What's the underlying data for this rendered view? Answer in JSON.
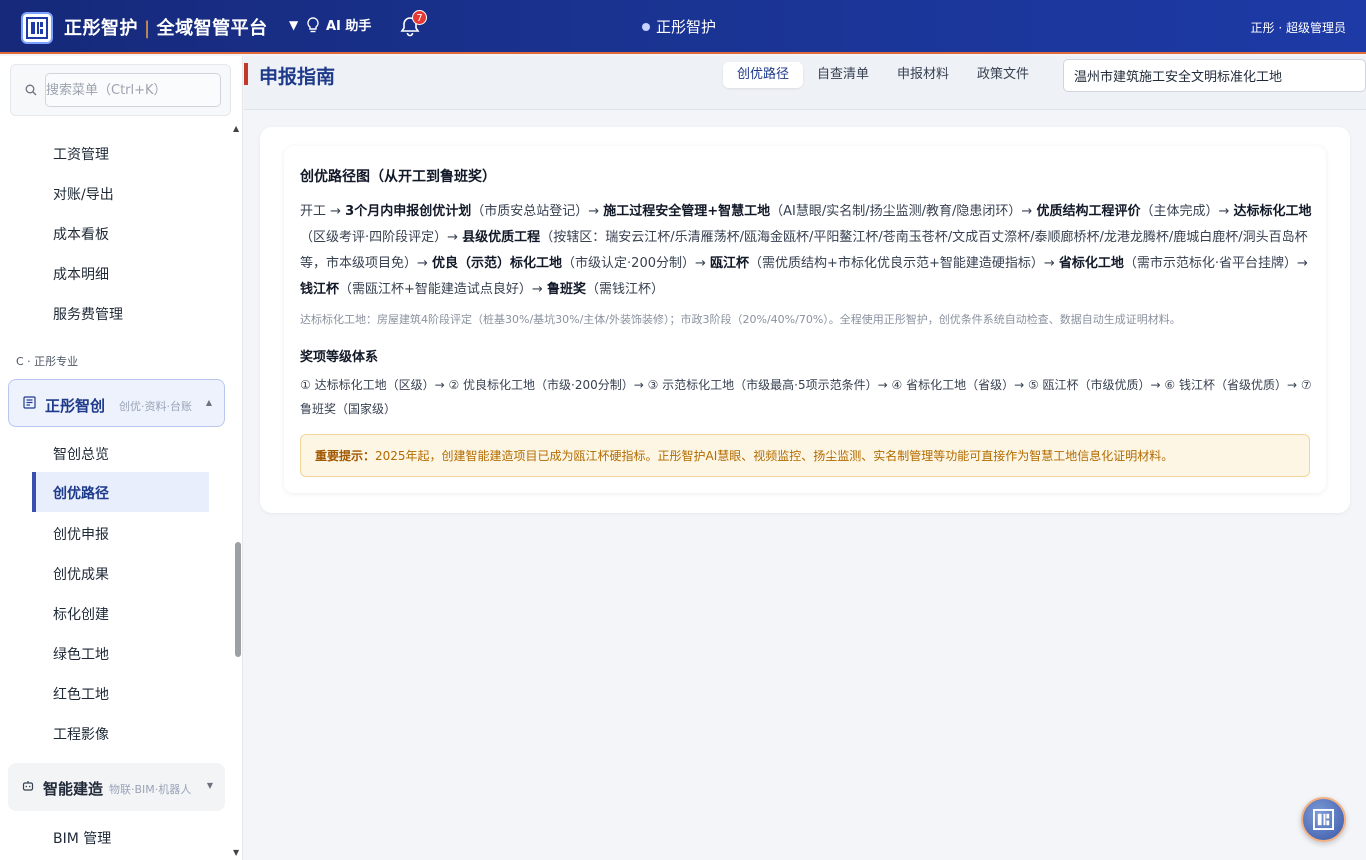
{
  "topbar": {
    "brand_name": "正彤智护",
    "brand_platform": "全域智管平台",
    "ai_label": "AI 助手",
    "notification_count": "7",
    "center_title": "正彤智护",
    "user_role": "正彤 · 超级管理员"
  },
  "sidebar": {
    "search_placeholder": "搜索菜单（Ctrl+K）",
    "items_top": [
      "工资管理",
      "对账/导出",
      "成本看板",
      "成本明细",
      "服务费管理"
    ],
    "section_label": "C · 正彤专业",
    "group_active": {
      "title": "正彤智创",
      "subtitle": "创优·资料·台账"
    },
    "group_items": [
      "智创总览",
      "创优路径",
      "创优申报",
      "创优成果",
      "标化创建",
      "绿色工地",
      "红色工地",
      "工程影像"
    ],
    "group_2": {
      "title": "智能建造",
      "subtitle": "物联·BIM·机器人"
    },
    "items_bottom": [
      "BIM 管理"
    ]
  },
  "header": {
    "page_title": "申报指南",
    "tabs": [
      "创优路径",
      "自查清单",
      "申报材料",
      "政策文件"
    ],
    "project_value": "温州市建筑施工安全文明标准化工地"
  },
  "content": {
    "title": "创优路径图（从开工到鲁班奖）",
    "path": [
      {
        "t": "开工 → ",
        "b": false
      },
      {
        "t": "3个月内申报创优计划",
        "b": true
      },
      {
        "t": "（市质安总站登记）→ ",
        "b": false
      },
      {
        "t": "施工过程安全管理+智慧工地",
        "b": true
      },
      {
        "t": "（AI慧眼/实名制/扬尘监测/教育/隐患闭环）→ ",
        "b": false
      },
      {
        "t": "优质结构工程评价",
        "b": true
      },
      {
        "t": "（主体完成）→ ",
        "b": false
      },
      {
        "t": "达标标化工地",
        "b": true
      },
      {
        "t": "（区级考评·四阶段评定）→ ",
        "b": false
      },
      {
        "t": "县级优质工程",
        "b": true
      },
      {
        "t": "（按辖区：瑞安云江杯/乐清雁荡杯/瓯海金瓯杯/平阳鳌江杯/苍南玉苍杯/文成百丈漈杯/泰顺廊桥杯/龙港龙腾杯/鹿城白鹿杯/洞头百岛杯等，市本级项目免）→ ",
        "b": false
      },
      {
        "t": "优良（示范）标化工地",
        "b": true
      },
      {
        "t": "（市级认定·200分制）→ ",
        "b": false
      },
      {
        "t": "瓯江杯",
        "b": true
      },
      {
        "t": "（需优质结构+市标化优良示范+智能建造硬指标）→ ",
        "b": false
      },
      {
        "t": "省标化工地",
        "b": true
      },
      {
        "t": "（需市示范标化·省平台挂牌）→ ",
        "b": false
      },
      {
        "t": "钱江杯",
        "b": true
      },
      {
        "t": "（需瓯江杯+智能建造试点良好）→ ",
        "b": false
      },
      {
        "t": "鲁班奖",
        "b": true
      },
      {
        "t": "（需钱江杯）",
        "b": false
      }
    ],
    "note": "达标标化工地：房屋建筑4阶段评定（桩基30%/基坑30%/主体/外装饰装修）；市政3阶段（20%/40%/70%）。全程使用正彤智护，创优条件系统自动检查、数据自动生成证明材料。",
    "levels_title": "奖项等级体系",
    "levels": "① 达标标化工地（区级）→ ② 优良标化工地（市级·200分制）→ ③ 示范标化工地（市级最高·5项示范条件）→ ④ 省标化工地（省级）→ ⑤ 瓯江杯（市级优质）→ ⑥ 钱江杯（省级优质）→ ⑦ 鲁班奖（国家级）",
    "tip_label": "重要提示：",
    "tip_text": "2025年起，创建智能建造项目已成为瓯江杯硬指标。正彤智护AI慧眼、视频监控、扬尘监测、实名制管理等功能可直接作为智慧工地信息化证明材料。"
  },
  "colors": {
    "topbar": "#1a3391",
    "accent": "#1e3a8a",
    "title_bar": "#c0392b",
    "tip_bg": "#fdf6e4",
    "tip_text": "#b36b00"
  },
  "icons": [
    "logo-icon",
    "lightbulb-icon",
    "bell-icon",
    "search-icon",
    "document-icon",
    "robot-icon"
  ]
}
